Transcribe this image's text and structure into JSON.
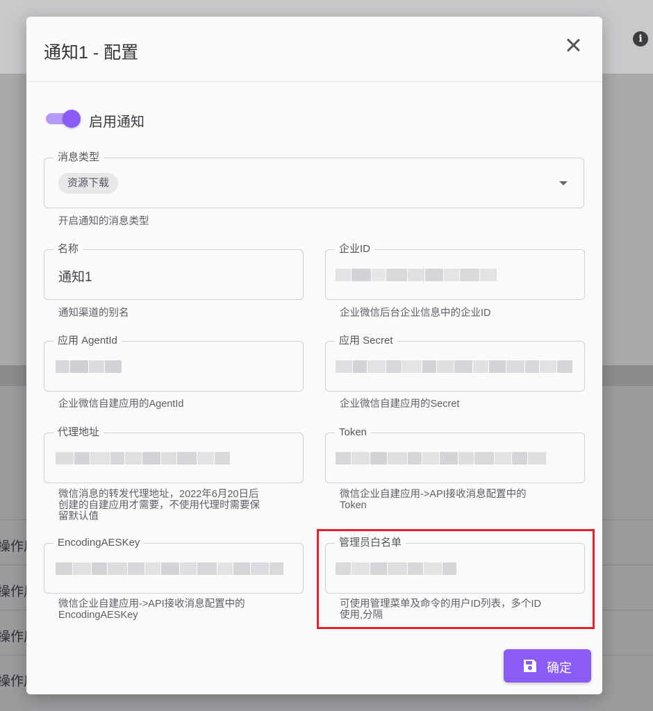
{
  "background": {
    "row_labels": [
      "操作用",
      "操作用",
      "操作用",
      "操作用"
    ]
  },
  "dialog": {
    "title": "通知1 - 配置",
    "enable_switch": {
      "label": "启用通知",
      "on": true
    },
    "message_type": {
      "label": "消息类型",
      "selected_chip": "资源下载",
      "helper": "开启通知的消息类型"
    },
    "name": {
      "label": "名称",
      "value": "通知1",
      "helper": "通知渠道的别名"
    },
    "corp_id": {
      "label": "企业ID",
      "value": "",
      "helper": "企业微信后台企业信息中的企业ID"
    },
    "agent_id": {
      "label": "应用 AgentId",
      "value": "",
      "helper": "企业微信自建应用的AgentId"
    },
    "secret": {
      "label": "应用 Secret",
      "value": "",
      "helper": "企业微信自建应用的Secret"
    },
    "proxy": {
      "label": "代理地址",
      "value": "",
      "helper_lines": [
        "微信消息的转发代理地址，2022年6月20日后",
        "创建的自建应用才需要，不使用代理时需要保",
        "留默认值"
      ]
    },
    "token": {
      "label": "Token",
      "value": "",
      "helper_lines": [
        "微信企业自建应用->API接收消息配置中的",
        "Token"
      ]
    },
    "aes_key": {
      "label": "EncodingAESKey",
      "value": "",
      "helper_lines": [
        "微信企业自建应用->API接收消息配置中的",
        "EncodingAESKey"
      ]
    },
    "admin_whitelist": {
      "label": "管理员白名单",
      "value": "",
      "helper_lines": [
        "可使用管理菜单及命令的用户ID列表，多个ID",
        "使用,分隔"
      ]
    },
    "confirm_button": "确定"
  },
  "colors": {
    "accent": "#8a5cf5",
    "accent_light": "#b59bf7",
    "highlight": "#e8202b",
    "dialog_bg": "#fafafa",
    "overlay": "#8c8c8f"
  },
  "icons": [
    "info-icon",
    "close-icon",
    "dropdown-arrow-icon",
    "save-icon"
  ]
}
